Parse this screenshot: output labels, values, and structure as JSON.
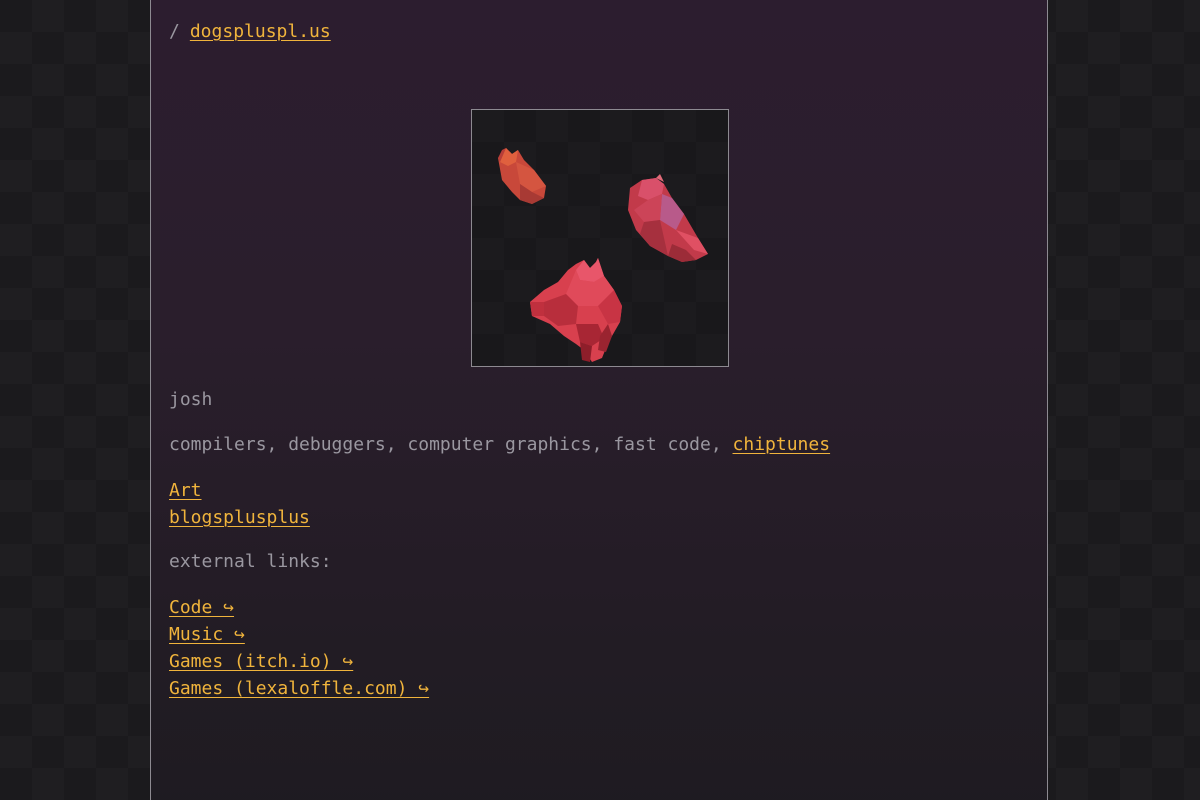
{
  "breadcrumb": {
    "separator": "/",
    "site_link": "dogspluspl.us"
  },
  "hero_image": {
    "description_icon": "three-red-lowpoly-dogs-icon",
    "accent": "#d9414f"
  },
  "profile": {
    "name": "josh",
    "tagline_prefix": "compilers, debuggers, computer graphics, fast code,",
    "tagline_link": "chiptunes"
  },
  "nav": {
    "items": [
      {
        "label": "Art"
      },
      {
        "label": "blogsplusplus"
      }
    ]
  },
  "external": {
    "heading": "external links:",
    "items": [
      {
        "label": "Code ↪"
      },
      {
        "label": "Music ↪"
      },
      {
        "label": "Games (itch.io) ↪"
      },
      {
        "label": "Games (lexaloffle.com) ↪"
      }
    ]
  },
  "colors": {
    "link": "#f0b43c",
    "text": "#9a97a0",
    "background": "#1b1a1d",
    "panel": "#2a1e2c",
    "border": "#8d8a91"
  }
}
